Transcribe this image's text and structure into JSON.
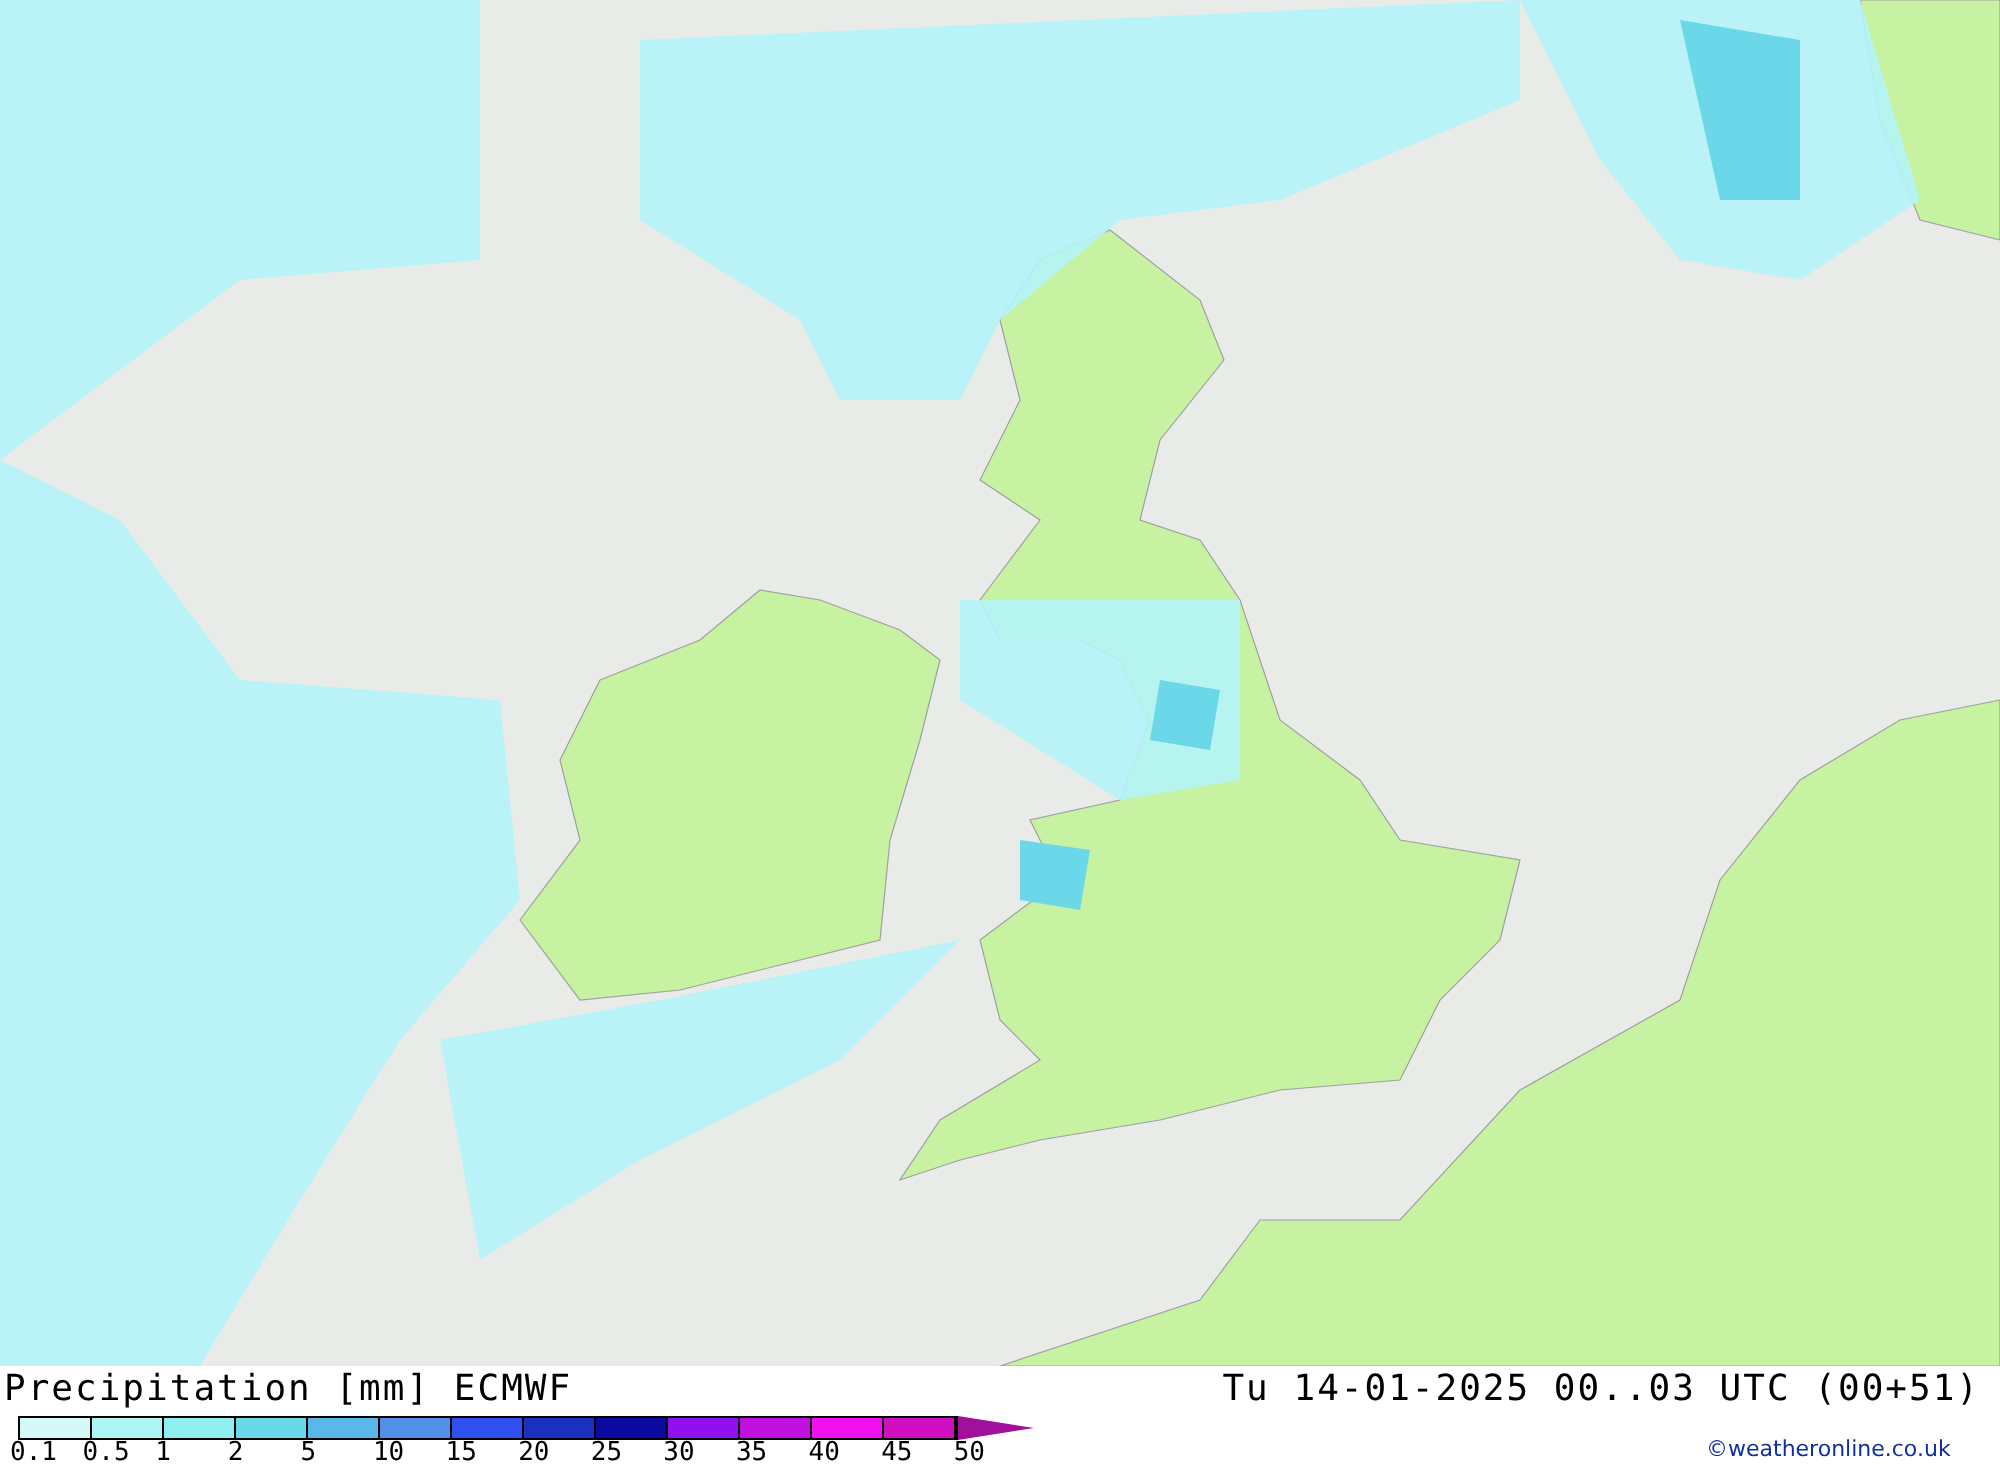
{
  "title": "Precipitation [mm] ECMWF",
  "valid_time": "Tu 14-01-2025 00..03 UTC (00+51)",
  "legend": {
    "bins": [
      {
        "color": "#d4f8f8"
      },
      {
        "color": "#aef5f6"
      },
      {
        "color": "#8eeef0"
      },
      {
        "color": "#6ad8e8"
      },
      {
        "color": "#5ab8e8"
      },
      {
        "color": "#5090e8"
      },
      {
        "color": "#3050f0"
      },
      {
        "color": "#1a30c0"
      },
      {
        "color": "#0a0aa0"
      },
      {
        "color": "#9010f0"
      },
      {
        "color": "#c010e0"
      },
      {
        "color": "#f010f0"
      },
      {
        "color": "#d010c0"
      },
      {
        "kind": "arrow",
        "color": "#a0109a"
      }
    ],
    "ticks": [
      "0.1",
      "0.5",
      "1",
      "2",
      "5",
      "10",
      "15",
      "20",
      "25",
      "30",
      "35",
      "40",
      "45",
      "50"
    ]
  },
  "credit": "©weatheronline.co.uk"
}
